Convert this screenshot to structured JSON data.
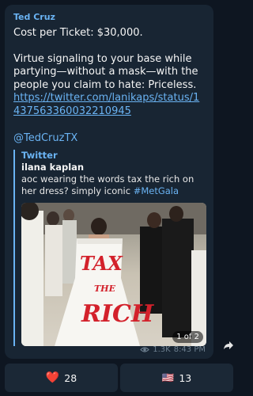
{
  "message": {
    "sender": "Ted Cruz",
    "line1": "Cost per Ticket: $30,000.",
    "line2": "Virtue signaling to your base while partying—without a mask—with the people you claim to hate: Priceless.",
    "link": "https://twitter.com/lanikaps/status/1437563360032210945",
    "mention": "@TedCruzTX"
  },
  "preview": {
    "site": "Twitter",
    "author": "ilana kaplan",
    "text": "aoc wearing the words tax the rich on her dress? simply iconic ",
    "hashtag": "#MetGala",
    "photo_counter": "1 of 2",
    "photo_dress_text": "TAX THE RICH"
  },
  "meta": {
    "views": "1.3K",
    "time": "8:43 PM"
  },
  "reactions": [
    {
      "emoji": "❤️",
      "count": "28",
      "icon": "heart-icon"
    },
    {
      "emoji": "🇺🇸",
      "count": "13",
      "icon": "us-flag-icon"
    }
  ],
  "colors": {
    "background": "#0e1621",
    "bubble": "#182533",
    "accent": "#6ab3f3"
  }
}
